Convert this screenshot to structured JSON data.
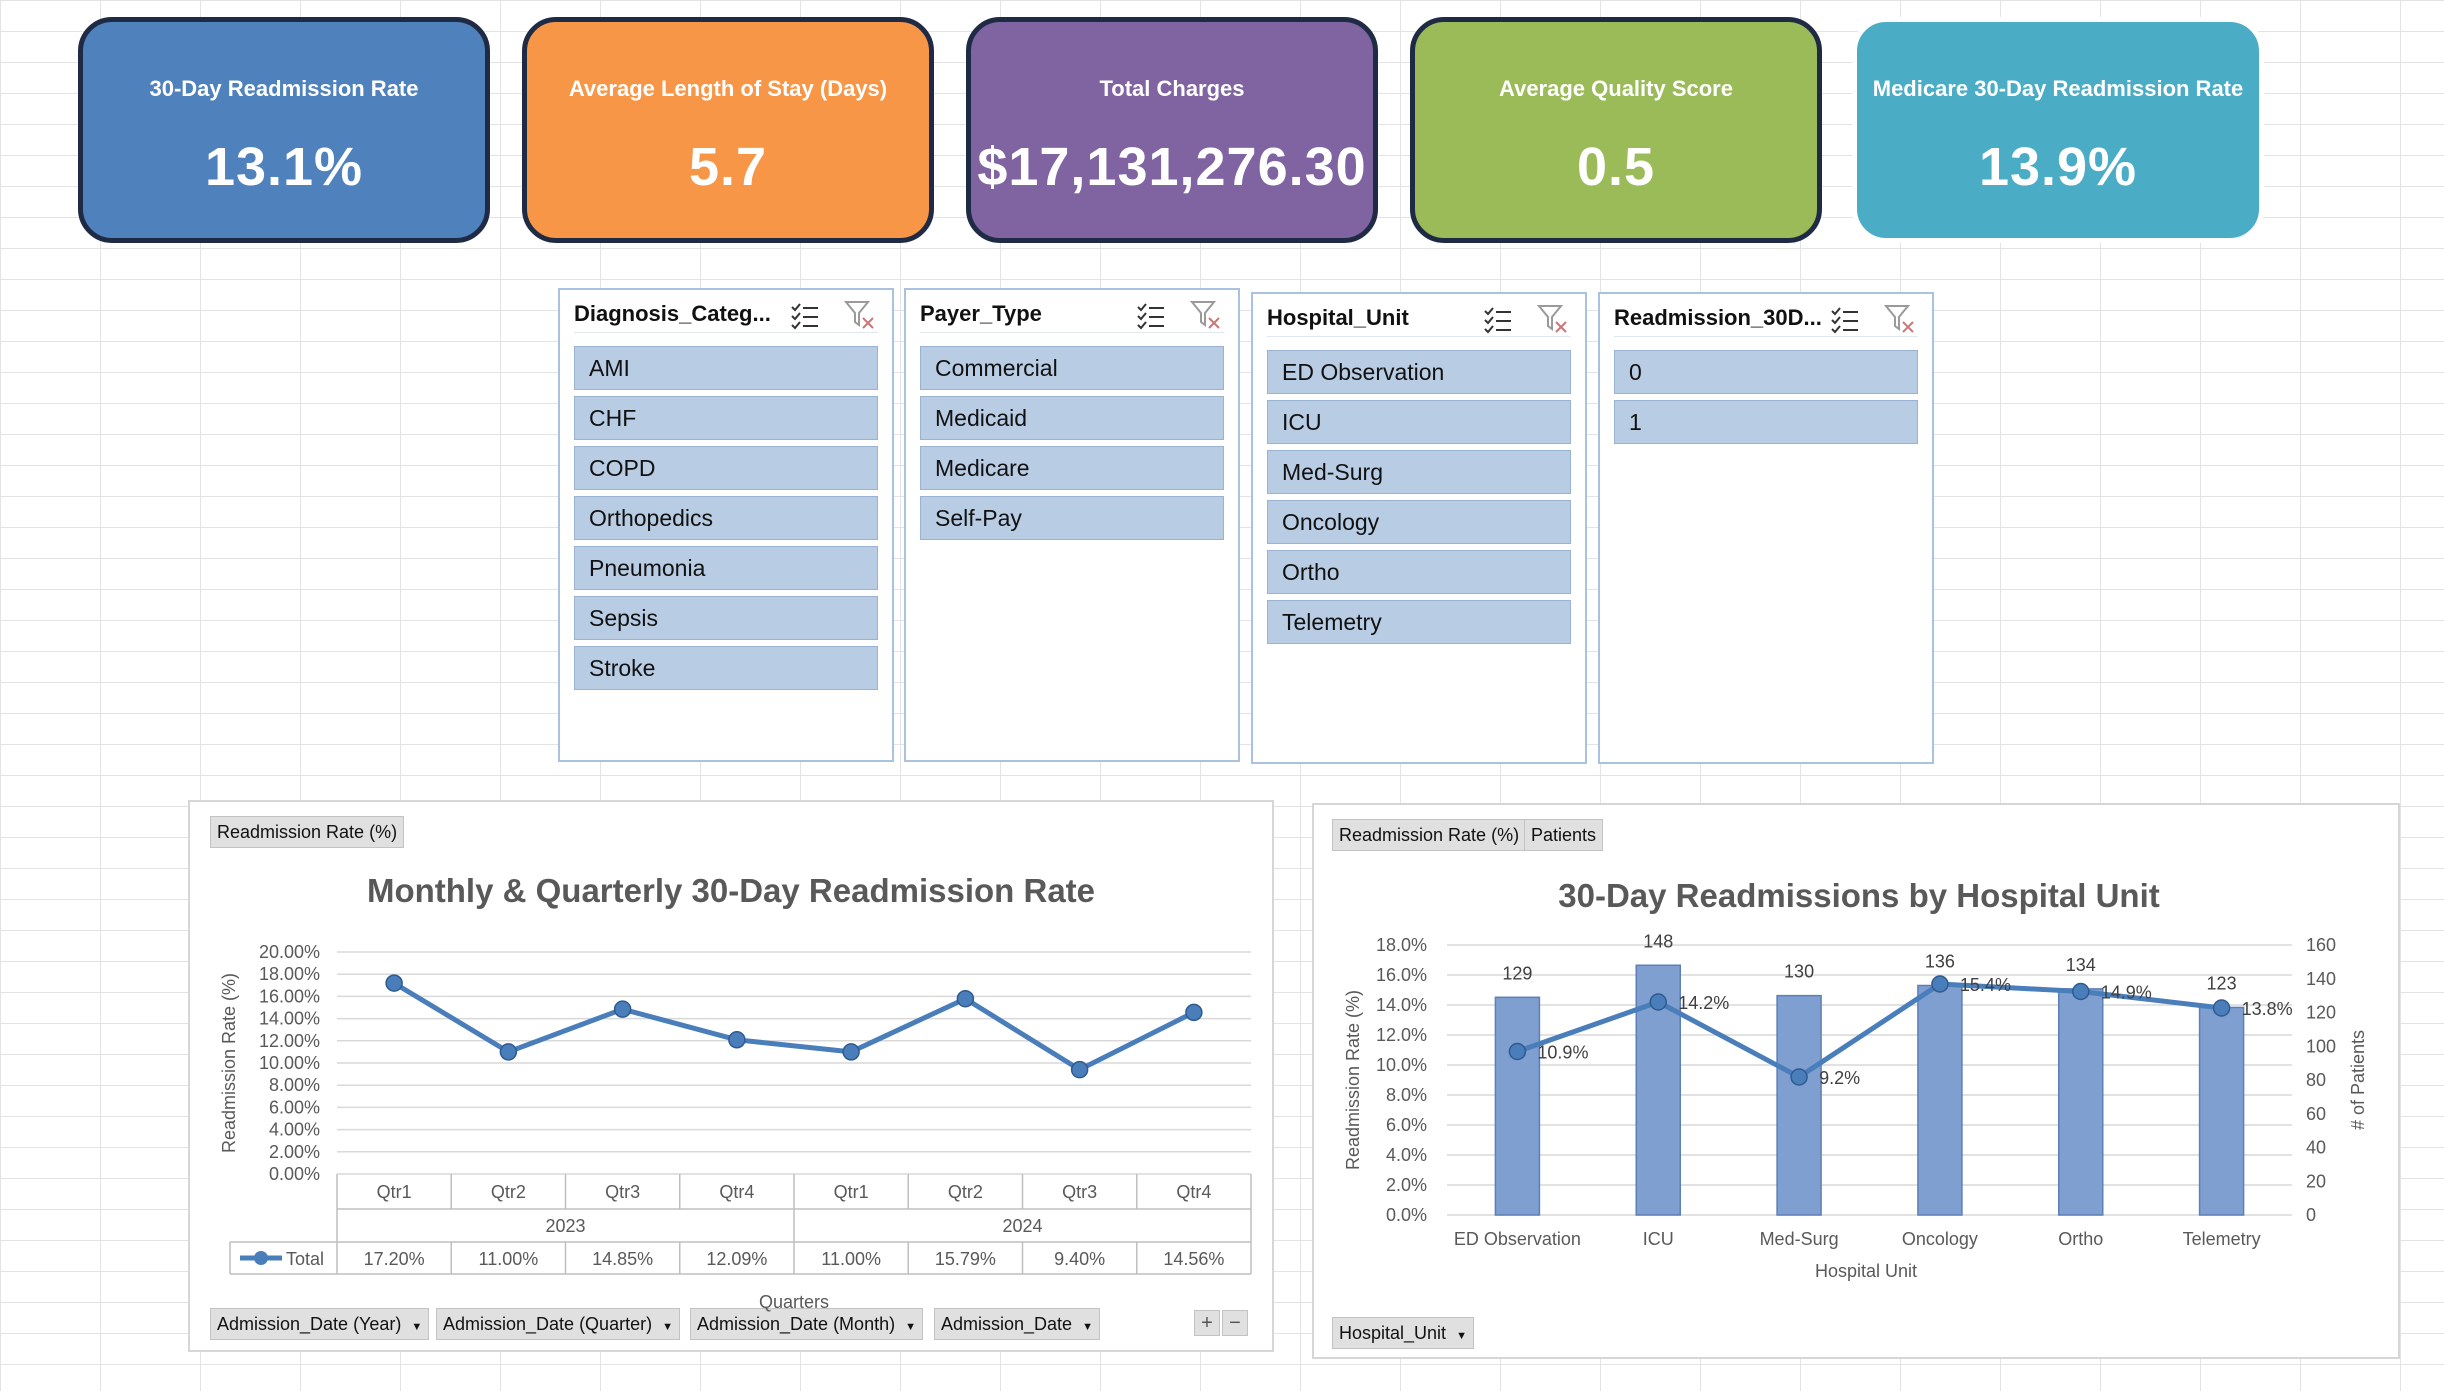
{
  "kpis": [
    {
      "title": "30-Day Readmission Rate",
      "value": "13.1%",
      "color": "#4f81bd"
    },
    {
      "title": "Average Length of Stay (Days)",
      "value": "5.7",
      "color": "#f79646"
    },
    {
      "title": "Total Charges",
      "value": "$17,131,276.30",
      "color": "#8064a2"
    },
    {
      "title": "Average Quality Score",
      "value": "0.5",
      "color": "#9bbb59"
    },
    {
      "title": "Medicare 30-Day Readmission Rate",
      "value": "13.9%",
      "color": "#4bacc6"
    }
  ],
  "slicers": [
    {
      "title": "Diagnosis_Categ...",
      "items": [
        "AMI",
        "CHF",
        "COPD",
        "Orthopedics",
        "Pneumonia",
        "Sepsis",
        "Stroke"
      ]
    },
    {
      "title": "Payer_Type",
      "items": [
        "Commercial",
        "Medicaid",
        "Medicare",
        "Self-Pay"
      ]
    },
    {
      "title": "Hospital_Unit",
      "items": [
        "ED Observation",
        "ICU",
        "Med-Surg",
        "Oncology",
        "Ortho",
        "Telemetry"
      ]
    },
    {
      "title": "Readmission_30D...",
      "items": [
        "0",
        "1"
      ]
    }
  ],
  "chart1": {
    "value_button": "Readmission Rate (%)",
    "axis_buttons": [
      "Admission_Date (Year)",
      "Admission_Date (Quarter)",
      "Admission_Date (Month)",
      "Admission_Date"
    ],
    "plus": "+",
    "minus": "−"
  },
  "chart2": {
    "value_buttons": [
      "Readmission Rate (%)",
      "Patients"
    ],
    "axis_button": "Hospital_Unit"
  },
  "chart_data": [
    {
      "type": "line",
      "title": "Monthly & Quarterly 30-Day Readmission Rate",
      "xlabel": "Quarters",
      "ylabel": "Readmission Rate (%)",
      "ylim": [
        0,
        20
      ],
      "y_ticks": [
        "0.00%",
        "2.00%",
        "4.00%",
        "6.00%",
        "8.00%",
        "10.00%",
        "12.00%",
        "14.00%",
        "16.00%",
        "18.00%",
        "20.00%"
      ],
      "groups": [
        {
          "label": "2023",
          "span": 4
        },
        {
          "label": "2024",
          "span": 4
        }
      ],
      "categories": [
        "Qtr1",
        "Qtr2",
        "Qtr3",
        "Qtr4",
        "Qtr1",
        "Qtr2",
        "Qtr3",
        "Qtr4"
      ],
      "series": [
        {
          "name": "Total",
          "values": [
            17.2,
            11.0,
            14.85,
            12.09,
            11.0,
            15.79,
            9.4,
            14.56
          ]
        }
      ],
      "table_values": [
        "17.20%",
        "11.00%",
        "14.85%",
        "12.09%",
        "11.00%",
        "15.79%",
        "9.40%",
        "14.56%"
      ],
      "color": "#4a7ebb",
      "grid": true
    },
    {
      "type": "bar",
      "title": "30-Day Readmissions by Hospital Unit",
      "xlabel": "Hospital Unit",
      "ylabel": "Readmission Rate (%)",
      "y2label": "# of Patients",
      "ylim": [
        0,
        18
      ],
      "y2lim": [
        0,
        160
      ],
      "y_ticks": [
        "0.0%",
        "2.0%",
        "4.0%",
        "6.0%",
        "8.0%",
        "10.0%",
        "12.0%",
        "14.0%",
        "16.0%",
        "18.0%"
      ],
      "y2_ticks": [
        "0",
        "20",
        "40",
        "60",
        "80",
        "100",
        "120",
        "140",
        "160"
      ],
      "categories": [
        "ED Observation",
        "ICU",
        "Med-Surg",
        "Oncology",
        "Ortho",
        "Telemetry"
      ],
      "series": [
        {
          "kind": "bar",
          "axis": "y2",
          "values": [
            129,
            148,
            130,
            136,
            134,
            123
          ],
          "labels": [
            "129",
            "148",
            "130",
            "136",
            "134",
            "123"
          ]
        },
        {
          "kind": "line",
          "axis": "y",
          "values": [
            10.9,
            14.2,
            9.2,
            15.4,
            14.9,
            13.8
          ],
          "labels": [
            "10.9%",
            "14.2%",
            "9.2%",
            "15.4%",
            "14.9%",
            "13.8%"
          ]
        }
      ],
      "bar_color": "#7f9fd1",
      "line_color": "#4a7ebb",
      "grid": true
    }
  ]
}
